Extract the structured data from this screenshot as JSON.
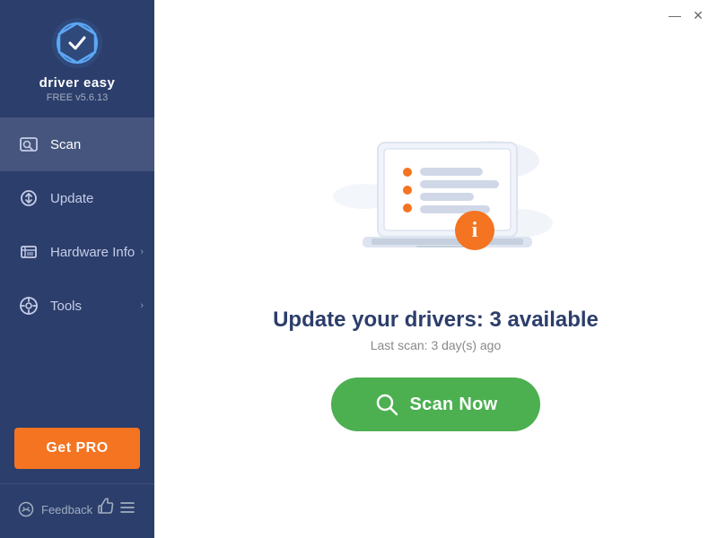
{
  "app": {
    "title": "Driver Easy",
    "version": "FREE v5.6.13",
    "logo_text": "driver easy"
  },
  "titlebar": {
    "minimize_label": "—",
    "close_label": "✕"
  },
  "sidebar": {
    "items": [
      {
        "id": "scan",
        "label": "Scan",
        "active": true,
        "has_chevron": false
      },
      {
        "id": "update",
        "label": "Update",
        "active": false,
        "has_chevron": false
      },
      {
        "id": "hardware-info",
        "label": "Hardware Info",
        "active": false,
        "has_chevron": true
      },
      {
        "id": "tools",
        "label": "Tools",
        "active": false,
        "has_chevron": true
      }
    ],
    "get_pro_label": "Get PRO",
    "feedback_label": "Feedback"
  },
  "main": {
    "title": "Update your drivers: 3 available",
    "subtitle": "Last scan: 3 day(s) ago",
    "scan_button_label": "Scan Now"
  },
  "colors": {
    "sidebar_bg": "#2c3e6b",
    "accent_green": "#4caf50",
    "accent_orange": "#f47421",
    "info_orange": "#f47421",
    "text_dark": "#2c3e6b",
    "text_gray": "#888888"
  }
}
